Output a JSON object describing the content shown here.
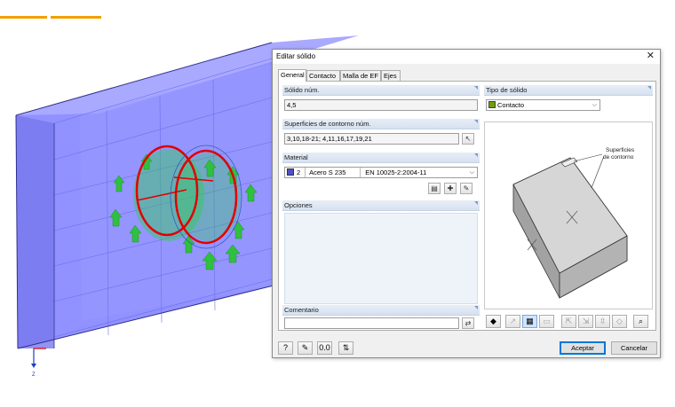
{
  "dialog": {
    "title": "Editar sólido",
    "tabs": [
      {
        "label": "General",
        "active": true
      },
      {
        "label": "Contacto",
        "active": false
      },
      {
        "label": "Malla de EF",
        "active": false
      },
      {
        "label": "Ejes",
        "active": false
      }
    ],
    "solid_number": {
      "label": "Sólido núm.",
      "value": "4,5"
    },
    "solid_type": {
      "label": "Tipo de sólido",
      "value": "Contacto",
      "color": "#6fa00a"
    },
    "surfaces": {
      "label": "Superficies de contorno núm.",
      "value": "3,10,18-21; 4,11,16,17,19,21"
    },
    "material": {
      "label": "Material",
      "number": "2",
      "name": "Acero S 235",
      "norm": "EN 10025-2:2004-11",
      "color": "#5050c8"
    },
    "options": {
      "label": "Opciones"
    },
    "comment": {
      "label": "Comentario",
      "value": ""
    },
    "preview": {
      "annotation_line1": "Superficies",
      "annotation_line2": "de contorno"
    },
    "buttons": {
      "accept": "Aceptar",
      "cancel": "Cancelar"
    }
  },
  "viewport": {
    "axis_label": "Z"
  },
  "colors": {
    "accent": "#0078d7",
    "solid_fill": "#8080ff",
    "support_green": "#33cc44",
    "orange_bar": "#f0a000",
    "red_cylinder": "#e00000"
  }
}
